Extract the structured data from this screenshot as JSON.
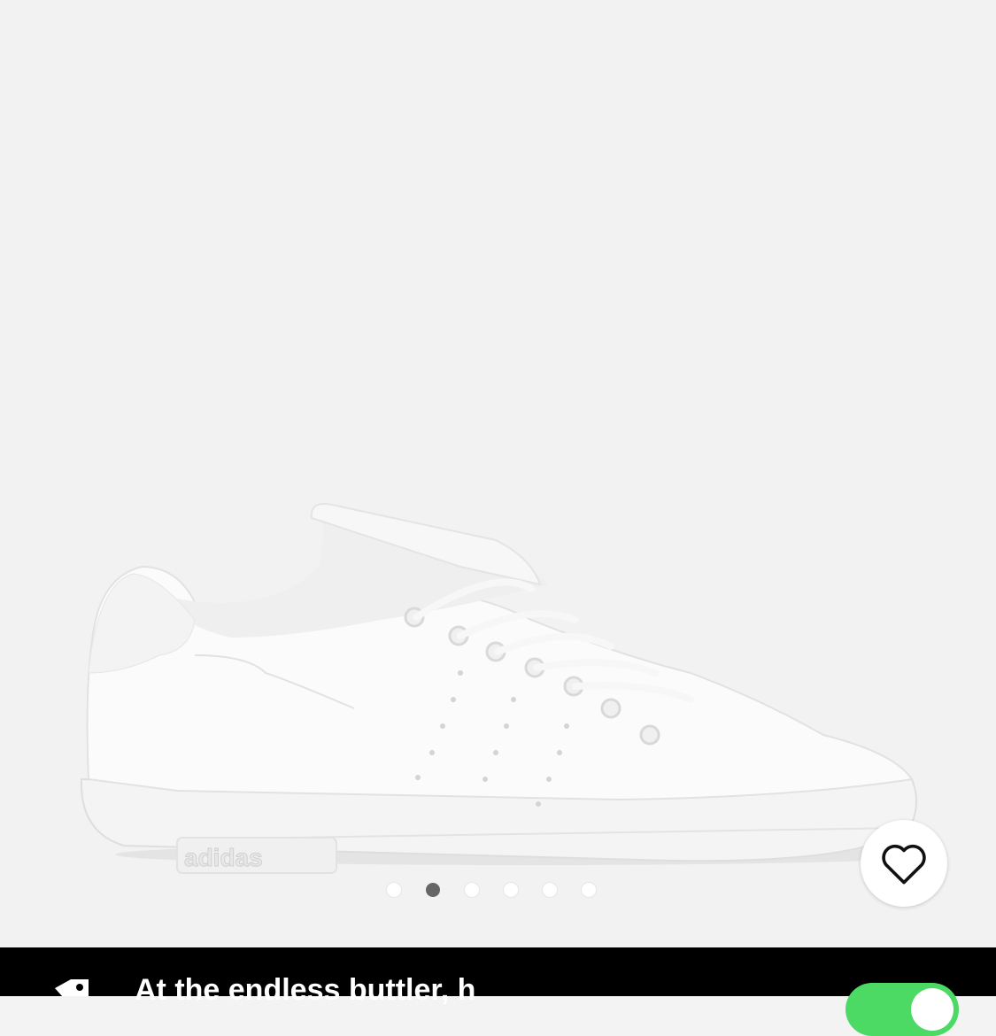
{
  "product": {
    "brand_mark": "adidas",
    "image_description_icon": "sneaker-image"
  },
  "carousel": {
    "total": 6,
    "active_index": 1
  },
  "favorite": {
    "icon": "heart-outline-icon"
  },
  "banner": {
    "text": "At the endless buttler, h",
    "icon": "price-tag-icon",
    "toggle_state": "on"
  },
  "colors": {
    "background": "#f2f2f2",
    "bar": "#000000",
    "toggle_on": "#4cd964",
    "dot_active": "#666666"
  }
}
